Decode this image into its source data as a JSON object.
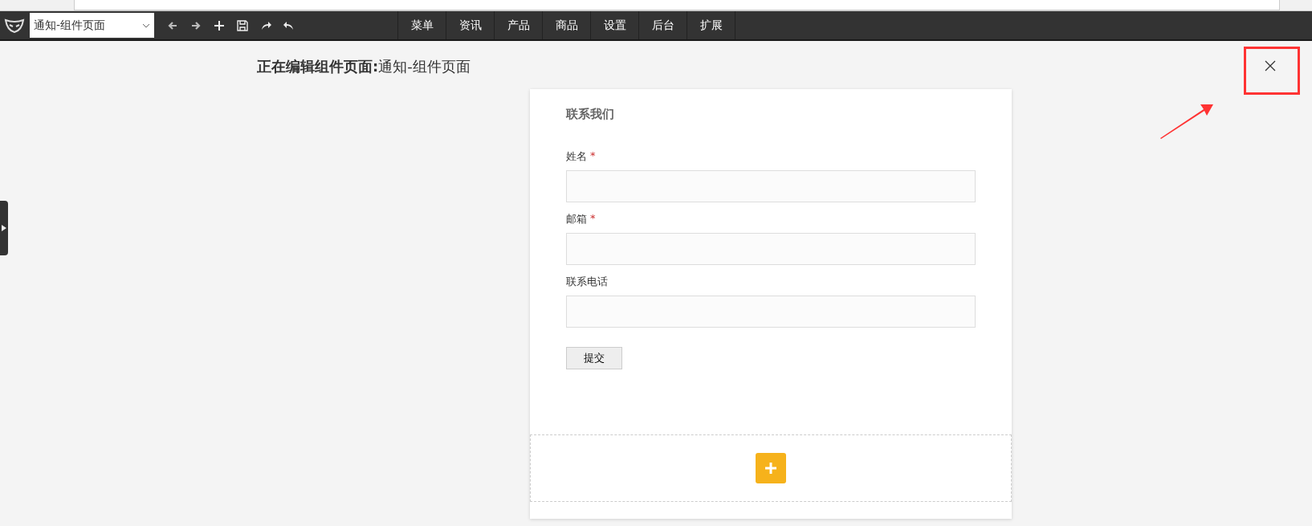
{
  "toolbar": {
    "page_select": "通知-组件页面",
    "menu": [
      {
        "label": "菜单"
      },
      {
        "label": "资讯"
      },
      {
        "label": "产品"
      },
      {
        "label": "商品"
      },
      {
        "label": "设置"
      },
      {
        "label": "后台"
      },
      {
        "label": "扩展"
      }
    ]
  },
  "heading": {
    "prefix": "正在编辑组件页面:",
    "page": "通知-组件页面"
  },
  "form": {
    "title": "联系我们",
    "fields": [
      {
        "label": "姓名",
        "required_mark": "*"
      },
      {
        "label": "邮箱",
        "required_mark": "*"
      },
      {
        "label": "联系电话"
      }
    ],
    "submit": "提交"
  }
}
